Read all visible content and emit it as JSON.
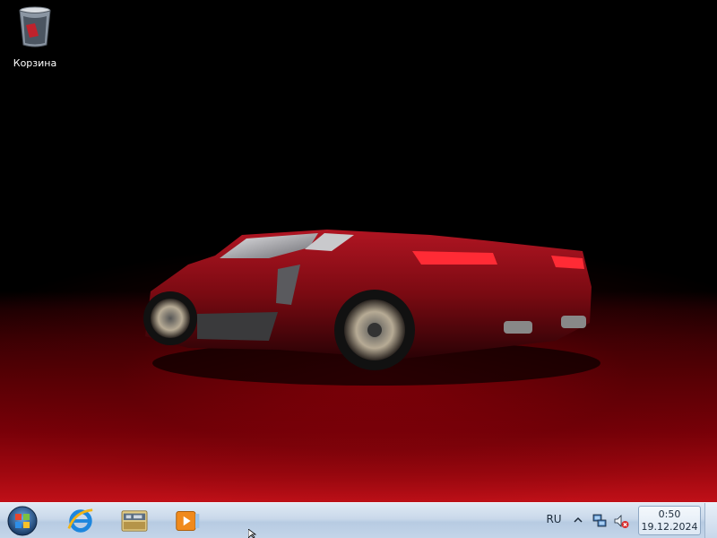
{
  "desktop": {
    "icons": [
      {
        "label": "Корзина",
        "icon": "recycle-bin-icon"
      }
    ]
  },
  "taskbar": {
    "start_icon": "windows-logo-icon",
    "pinned": [
      {
        "name": "Internet Explorer",
        "icon": "internet-explorer-icon"
      },
      {
        "name": "Explorer",
        "icon": "file-explorer-icon"
      },
      {
        "name": "Windows Media Player",
        "icon": "media-player-icon"
      }
    ],
    "tray": {
      "language": "RU",
      "show_hidden_icon": "chevron-up-icon",
      "network_icon": "network-icon",
      "volume_icon": "volume-muted-icon",
      "time": "0:50",
      "date": "19.12.2024"
    }
  },
  "colors": {
    "taskbar_top": "#dfe9f4",
    "taskbar_bottom": "#c4d5e9",
    "floor_red": "#c01018",
    "car_red": "#8a0a12"
  }
}
